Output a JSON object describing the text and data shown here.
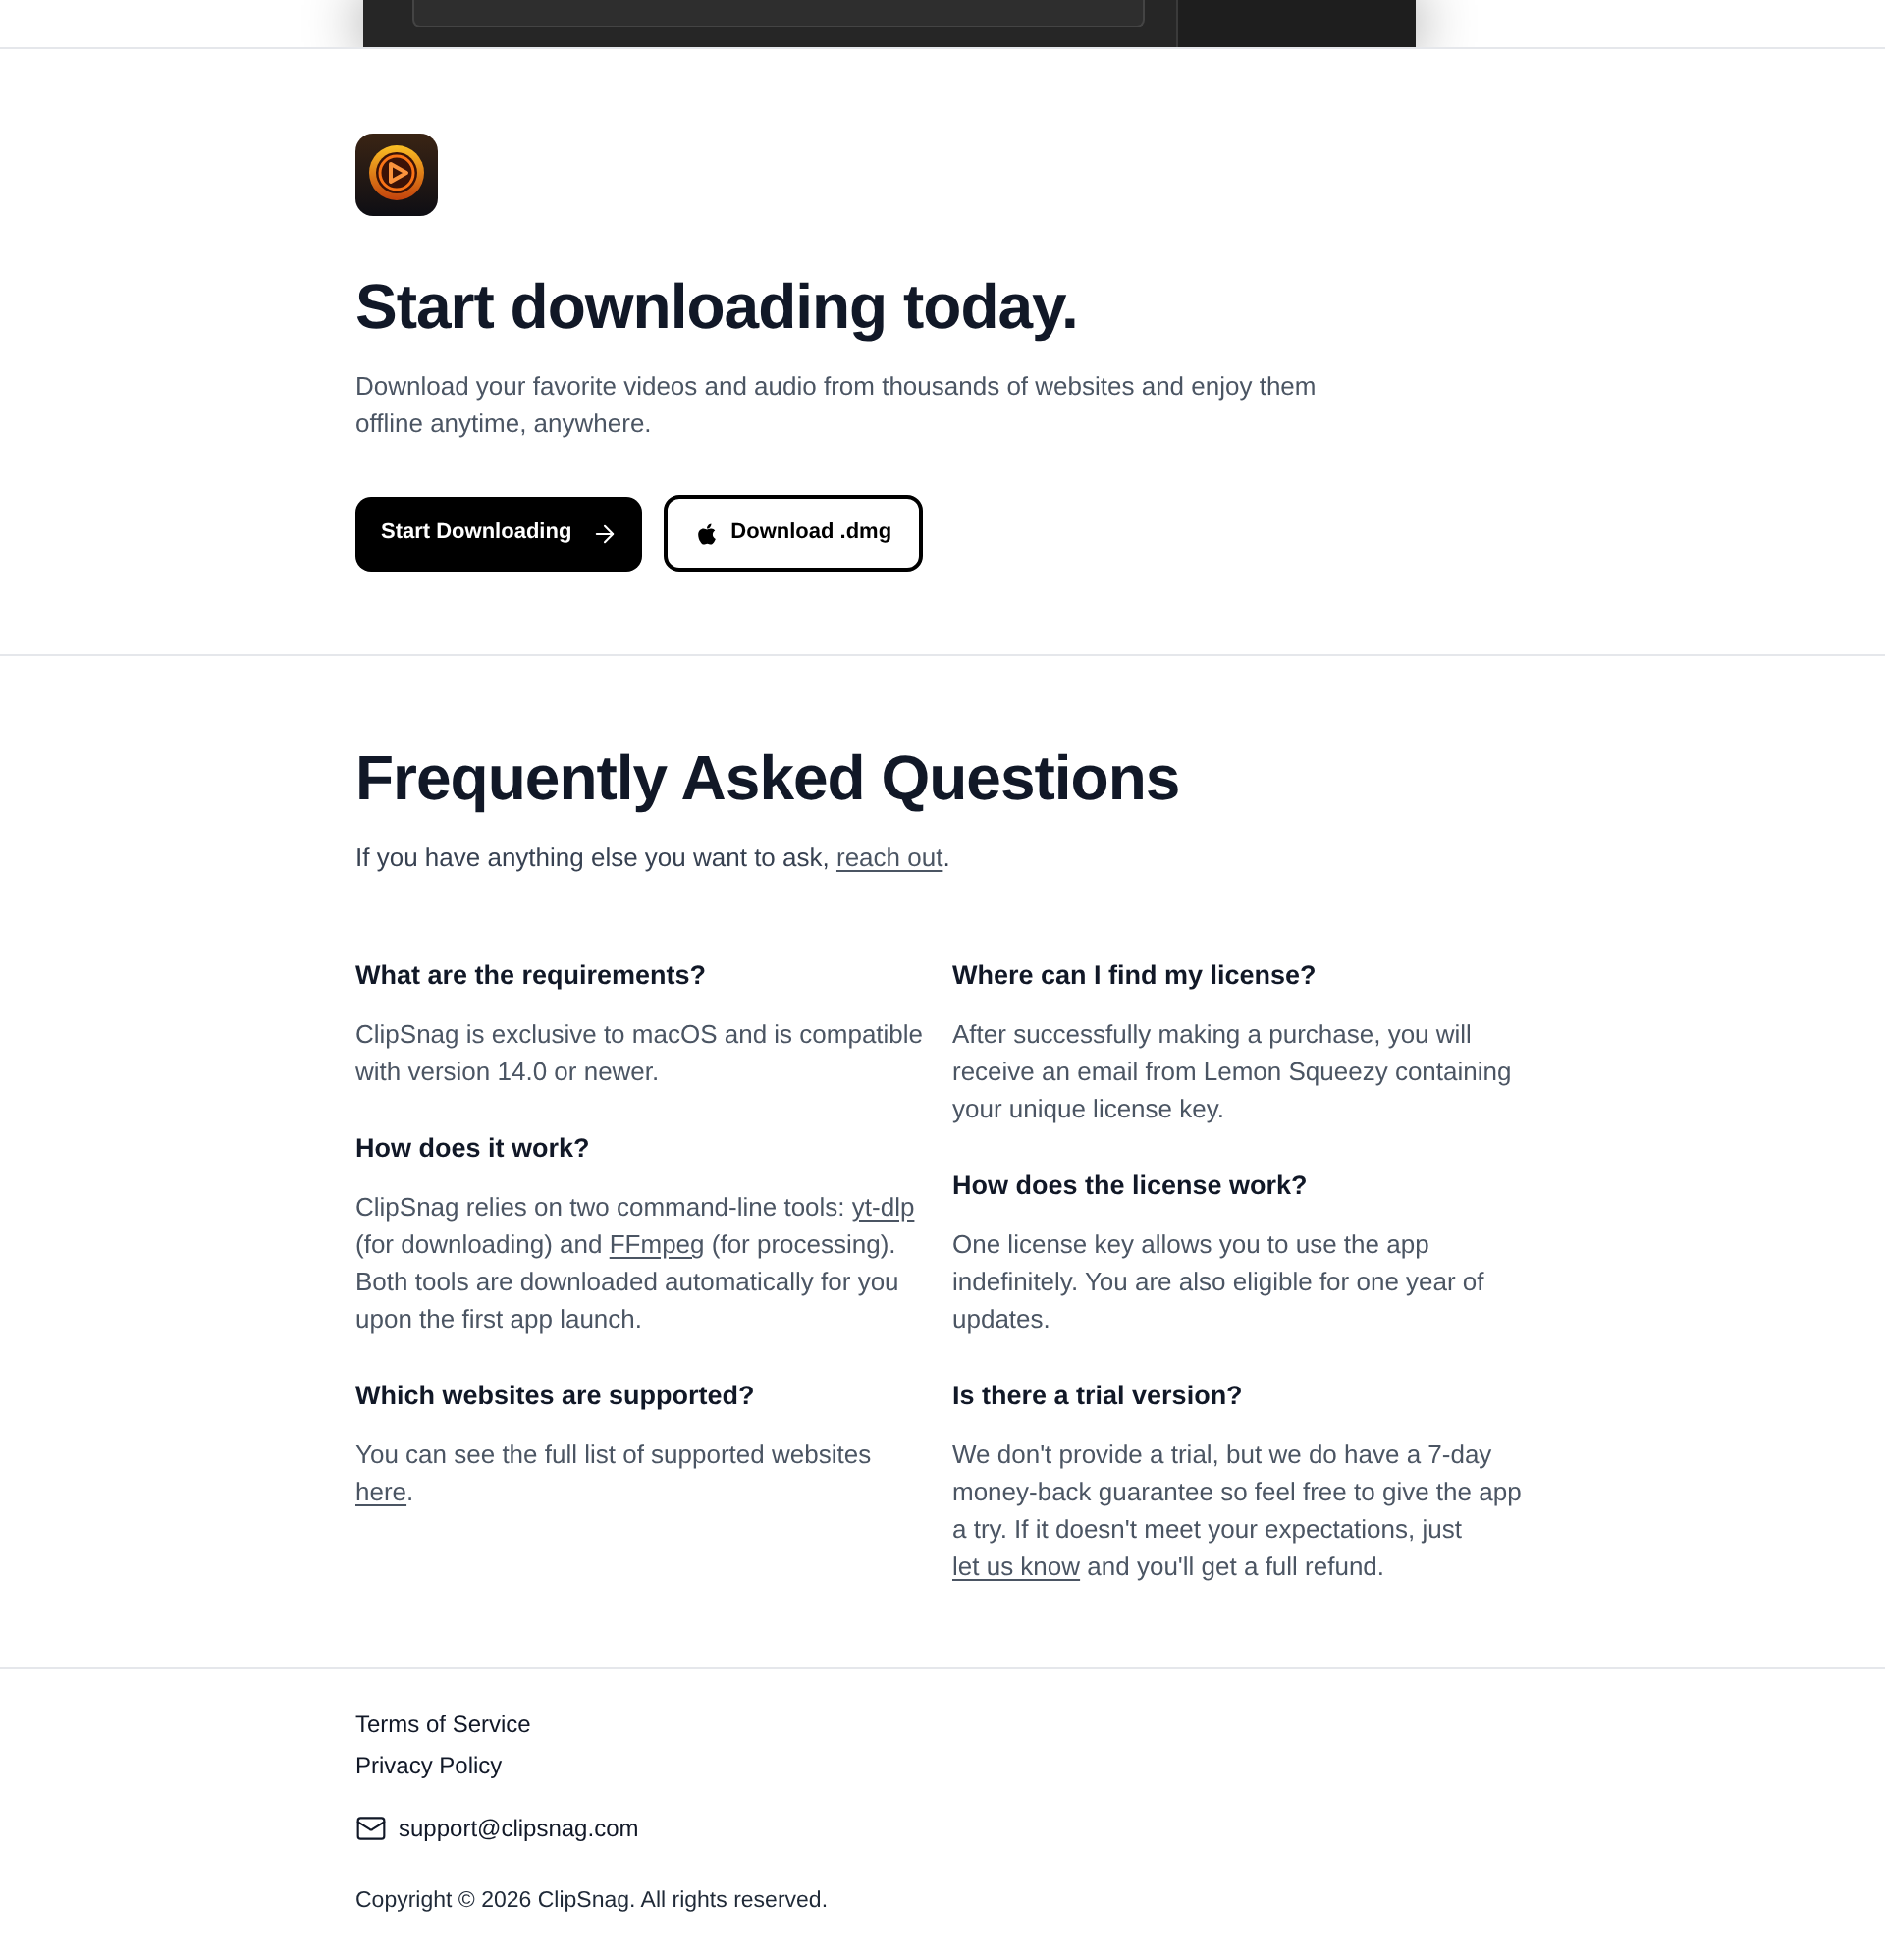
{
  "hero": {
    "title": "Start downloading today.",
    "description": "Download your favorite videos and audio from thousands of websites and enjoy them offline anytime, anywhere.",
    "buttons": [
      {
        "label": "Start Downloading",
        "kind": "primary"
      },
      {
        "label": "Download .dmg",
        "kind": "secondary"
      }
    ]
  },
  "faq": {
    "title": "Frequently Asked Questions",
    "intro": [
      {
        "kind": "text",
        "text": "If you have anything else you want to ask, "
      },
      {
        "kind": "link",
        "text": "reach out"
      },
      {
        "kind": "text",
        "text": "."
      }
    ],
    "columns": [
      {
        "questions": [
          {
            "question": "What are the requirements?",
            "answer": [
              {
                "kind": "text",
                "text": "ClipSnag is exclusive to macOS and is compatible with version 14.0 or newer."
              }
            ]
          },
          {
            "question": "How does it work?",
            "answer": [
              {
                "kind": "text",
                "text": "ClipSnag relies on two command-line tools: "
              },
              {
                "kind": "link",
                "text": "yt-dlp"
              },
              {
                "kind": "text",
                "text": " (for downloading) and "
              },
              {
                "kind": "link",
                "text": "FFmpeg"
              },
              {
                "kind": "text",
                "text": " (for processing). Both tools are downloaded automatically for you upon the first app launch."
              }
            ]
          },
          {
            "question": "Which websites are supported?",
            "answer": [
              {
                "kind": "text",
                "text": "You can see the full list of supported websites "
              },
              {
                "kind": "link",
                "text": "here"
              },
              {
                "kind": "text",
                "text": "."
              }
            ]
          }
        ]
      },
      {
        "questions": [
          {
            "question": "Where can I find my license?",
            "answer": [
              {
                "kind": "text",
                "text": "After successfully making a purchase, you will receive an email from Lemon Squeezy containing your unique license key."
              }
            ]
          },
          {
            "question": "How does the license work?",
            "answer": [
              {
                "kind": "text",
                "text": "One license key allows you to use the app indefinitely. You are also eligible for one year of updates."
              }
            ]
          },
          {
            "question": "Is there a trial version?",
            "answer": [
              {
                "kind": "text",
                "text": "We don't provide a trial, but we do have a 7-day money-back guarantee so feel free to give the app a try. If it doesn't meet your expectations, just "
              },
              {
                "kind": "link",
                "text": "let us know"
              },
              {
                "kind": "text",
                "text": " and you'll get a full refund."
              }
            ]
          }
        ]
      }
    ]
  },
  "footer": {
    "links": [
      "Terms of Service",
      "Privacy Policy"
    ],
    "email": "support@clipsnag.com",
    "copyright": "Copyright © 2026 ClipSnag. All rights reserved."
  }
}
